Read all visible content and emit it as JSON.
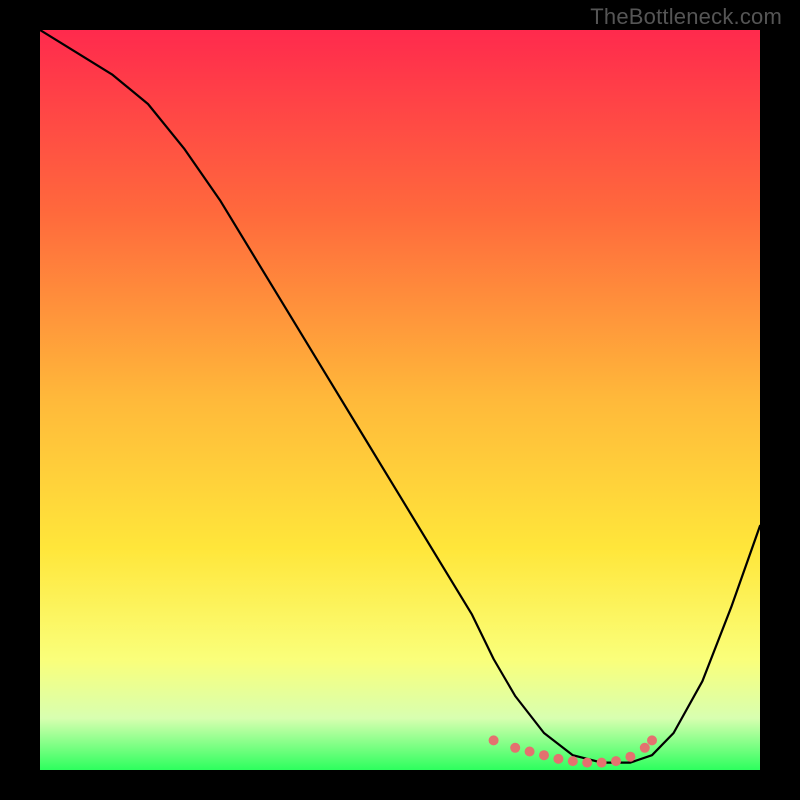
{
  "watermark": "TheBottleneck.com",
  "colors": {
    "gradient_stops": [
      {
        "offset": "0%",
        "color": "#ff2a4d"
      },
      {
        "offset": "25%",
        "color": "#ff6a3c"
      },
      {
        "offset": "50%",
        "color": "#ffb93a"
      },
      {
        "offset": "70%",
        "color": "#ffe63a"
      },
      {
        "offset": "85%",
        "color": "#faff7a"
      },
      {
        "offset": "93%",
        "color": "#d8ffb0"
      },
      {
        "offset": "100%",
        "color": "#2dff5e"
      }
    ],
    "curve_stroke": "#000000",
    "marker_fill": "#e4716f",
    "background": "#000000"
  },
  "chart_data": {
    "type": "line",
    "title": "",
    "xlabel": "",
    "ylabel": "",
    "xlim": [
      0,
      100
    ],
    "ylim": [
      0,
      100
    ],
    "x": [
      0,
      5,
      10,
      15,
      20,
      25,
      30,
      35,
      40,
      45,
      50,
      55,
      60,
      63,
      66,
      70,
      74,
      78,
      82,
      85,
      88,
      92,
      96,
      100
    ],
    "values": [
      100,
      97,
      94,
      90,
      84,
      77,
      69,
      61,
      53,
      45,
      37,
      29,
      21,
      15,
      10,
      5,
      2,
      1,
      1,
      2,
      5,
      12,
      22,
      33
    ],
    "markers_x": [
      63,
      66,
      68,
      70,
      72,
      74,
      76,
      78,
      80,
      82,
      84,
      85
    ],
    "markers_y": [
      4,
      3,
      2.5,
      2,
      1.5,
      1.2,
      1,
      1,
      1.2,
      1.8,
      3,
      4
    ]
  }
}
